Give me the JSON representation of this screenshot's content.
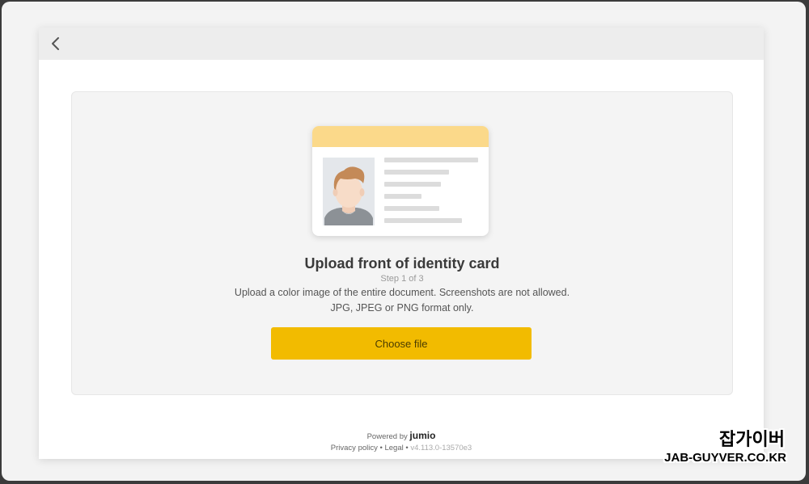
{
  "header": {
    "back_icon": "chevron-left-icon"
  },
  "card_illustration": {
    "icon": "id-card-icon",
    "header_color": "#fbd98a",
    "hair_color": "#c48a58",
    "skin_color": "#f7dcc8",
    "shirt_color": "#8c9196"
  },
  "main": {
    "title": "Upload front of identity card",
    "step": "Step 1 of 3",
    "description": "Upload a color image of the entire document. Screenshots are not allowed. JPG, JPEG or PNG format only.",
    "choose_label": "Choose file",
    "button_color": "#f2bb00"
  },
  "footer": {
    "powered_by": "Powered by",
    "brand": "jumio",
    "privacy": "Privacy policy",
    "separator": "•",
    "legal": "Legal",
    "version": "v4.113.0-13570e3"
  },
  "watermark": {
    "line1": "잡가이버",
    "line2": "JAB-GUYVER.CO.KR"
  }
}
